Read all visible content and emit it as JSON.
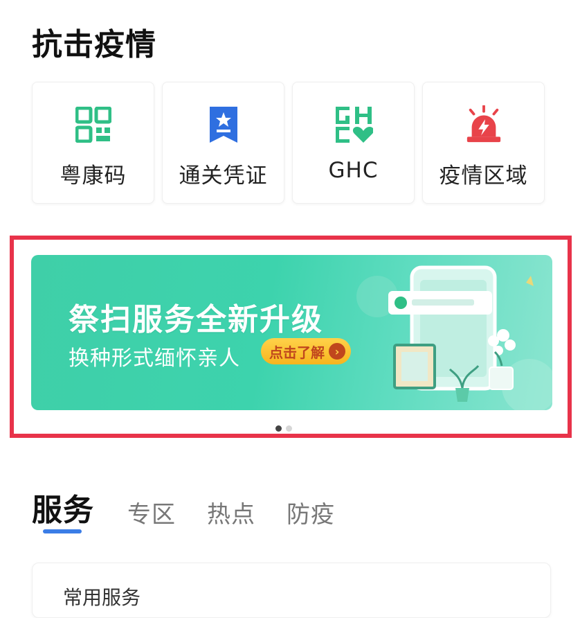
{
  "section": {
    "title": "抗击疫情"
  },
  "quick_actions": [
    {
      "label": "粤康码",
      "icon": "qr-code-icon"
    },
    {
      "label": "通关凭证",
      "icon": "bookmark-star-icon"
    },
    {
      "label": "GHC",
      "icon": "ghc-heart-icon"
    },
    {
      "label": "疫情区域",
      "icon": "alarm-light-icon"
    }
  ],
  "banner": {
    "title": "祭扫服务全新升级",
    "subtitle": "换种形式缅怀亲人",
    "cta": "点击了解"
  },
  "carousel": {
    "total": 2,
    "active": 0
  },
  "tabs": [
    {
      "label": "服务",
      "active": true
    },
    {
      "label": "专区",
      "active": false
    },
    {
      "label": "热点",
      "active": false
    },
    {
      "label": "防疫",
      "active": false
    }
  ],
  "service_card": {
    "title": "常用服务"
  },
  "colors": {
    "brand_green": "#2fbf86",
    "highlight_red": "#e8334a",
    "tab_blue": "#3b7de6",
    "alert_red": "#e8434a",
    "pass_blue": "#2f6fe0"
  }
}
